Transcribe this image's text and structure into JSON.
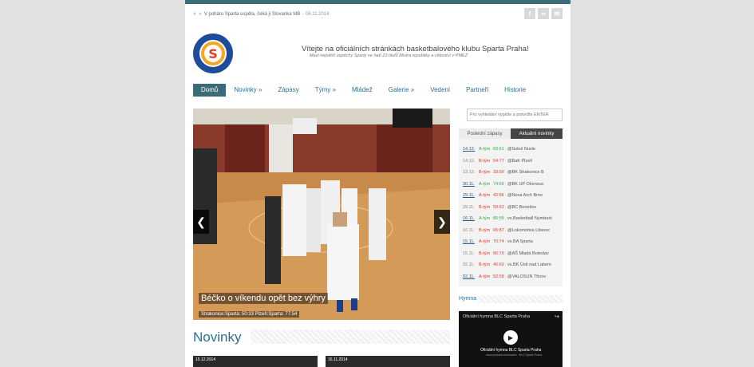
{
  "header": {
    "ticker_prev": "«",
    "ticker_next": "»",
    "ticker_text": "V poháru Sparta uspěla, čeká ji Slovanka MB",
    "ticker_date": "- 06.11.2014",
    "social": [
      {
        "icon": "facebook-icon",
        "glyph": "f"
      },
      {
        "icon": "flickr-icon",
        "glyph": "••"
      },
      {
        "icon": "mail-icon",
        "glyph": "✉"
      }
    ],
    "welcome": "Vítejte na oficiálních stránkách basketbalového klubu Sparta Praha!",
    "subwelcome": "Mezi největší úspěchy Sparty se řadí 23 titulů Mistra republiky a vítězství v PMEZ",
    "logo_letter": "S"
  },
  "nav": {
    "items": [
      "Domů",
      "Novinky »",
      "Zápasy",
      "Týmy »",
      "Mládež",
      "Galerie »",
      "Vedení",
      "Partneři",
      "Historie"
    ]
  },
  "slider": {
    "prev": "❮",
    "next": "❯",
    "caption_title": "Béčko o víkendu opět bez výhry",
    "caption_sub": "Strakonice:Sparta: 50:33 Plzeň:Sparta: 77:54"
  },
  "news": {
    "heading": "Novinky",
    "cards": [
      "15.12.2014",
      "16.11.2014"
    ]
  },
  "sidebar": {
    "search_placeholder": "Pro vyhledání vypište a potvrďte ENTER",
    "tab_results": "Poslední zápasy",
    "tab_news": "Aktuální novinky",
    "results": [
      {
        "date": "14.12.",
        "team": "A-tým",
        "score": "83:61",
        "opponent": "@Sokol Nusle",
        "color": "#3aa54a",
        "date_color": "#1f5b8a"
      },
      {
        "date": "14.12.",
        "team": "B-tým",
        "score": "54:77",
        "opponent": "@BaK Plzeň",
        "color": "#e53a2e",
        "date_color": "#888"
      },
      {
        "date": "13.12.",
        "team": "B-tým",
        "score": "33:50",
        "opponent": "@BK Strakonice B",
        "color": "#e53a2e",
        "date_color": "#888"
      },
      {
        "date": "30.11.",
        "team": "A-tým",
        "score": "74:66",
        "opponent": "@BK UP Olomouc",
        "color": "#3aa54a",
        "date_color": "#1f5b8a"
      },
      {
        "date": "29.11.",
        "team": "A-tým",
        "score": "42:86",
        "opponent": "@Nova Arch Brno",
        "color": "#e53a2e",
        "date_color": "#1f5b8a"
      },
      {
        "date": "29.11.",
        "team": "B-tým",
        "score": "59:62",
        "opponent": "@BC Benešov",
        "color": "#e53a2e",
        "date_color": "#888"
      },
      {
        "date": "16.11.",
        "team": "A-tým",
        "score": "85:55",
        "opponent": "vs.Basketball Nymburk",
        "color": "#3aa54a",
        "date_color": "#1f5b8a"
      },
      {
        "date": "16.11.",
        "team": "B-tým",
        "score": "65:87",
        "opponent": "@Lokomotiva Liberec",
        "color": "#e53a2e",
        "date_color": "#888"
      },
      {
        "date": "15.11.",
        "team": "A-tým",
        "score": "70:74",
        "opponent": "vs.BA Sparta",
        "color": "#e53a2e",
        "date_color": "#1f5b8a"
      },
      {
        "date": "15.11.",
        "team": "B-tým",
        "score": "66:70",
        "opponent": "@AŠ Mladá Boleslav",
        "color": "#e53a2e",
        "date_color": "#888"
      },
      {
        "date": "02.11.",
        "team": "B-tým",
        "score": "40:60",
        "opponent": "vs.BK Ústí nad Labem",
        "color": "#e53a2e",
        "date_color": "#888"
      },
      {
        "date": "02.11.",
        "team": "A-tým",
        "score": "52:58",
        "opponent": "@VALOSUN Třinov",
        "color": "#e53a2e",
        "date_color": "#1f5b8a"
      }
    ],
    "hymna_label": "Hymna",
    "video_title": "Oficiální hymna BLC Sparta Praha",
    "video_share": "↪",
    "video_play": "▶",
    "video_sub": "Oficiální hymna BLC Sparta Praha",
    "video_small": "www.youtube.com/watch · BLC Sparta Praha"
  }
}
